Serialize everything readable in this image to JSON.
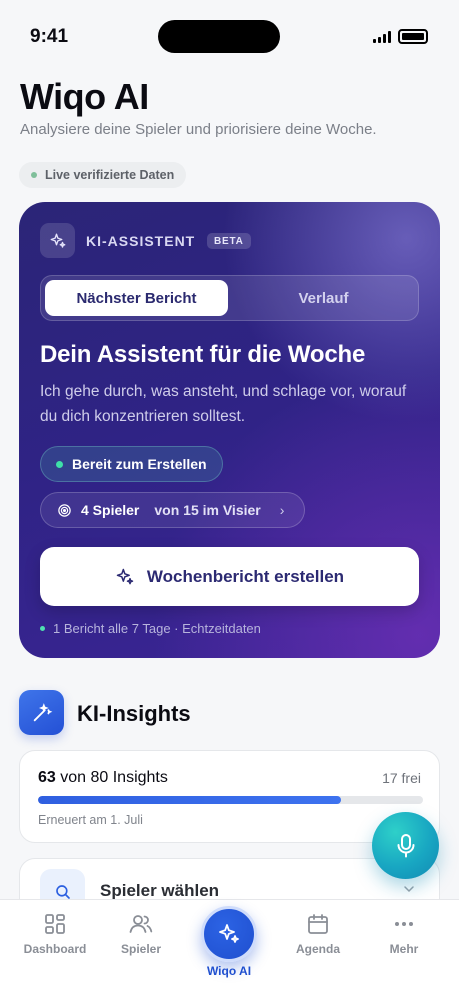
{
  "status_bar": {
    "time": "9:41"
  },
  "header": {
    "title": "Wiqo AI",
    "subtitle": "Analysiere deine Spieler und priorisiere deine Woche.",
    "live_badge": "Live verifizierte Daten"
  },
  "assistant": {
    "label": "KI-ASSISTENT",
    "badge": "BETA",
    "tabs": [
      {
        "label": "Nächster Bericht",
        "active": true
      },
      {
        "label": "Verlauf",
        "active": false
      }
    ],
    "heading": "Dein Assistent für die Woche",
    "description": "Ich gehe durch, was ansteht, und schlage vor, worauf du dich konzentrieren solltest.",
    "status": "Bereit zum Erstellen",
    "focus": {
      "count_label": "4 Spieler",
      "rest_label": "von 15 im Visier"
    },
    "button_label": "Wochenbericht erstellen",
    "footer": "1 Bericht alle 7 Tage · Echtzeitdaten"
  },
  "insights": {
    "title": "KI-Insights",
    "used": "63",
    "used_suffix": "von 80 Insights",
    "free": "17 frei",
    "progress": 0.7875,
    "renewed": "Erneuert am 1. Juli"
  },
  "select_player": {
    "label": "Spieler wählen"
  },
  "tab_bar": {
    "items": [
      {
        "label": "Dashboard",
        "icon": "grid-icon"
      },
      {
        "label": "Spieler",
        "icon": "users-icon"
      },
      {
        "label": "Wiqo AI",
        "icon": "sparkles-icon",
        "active": true
      },
      {
        "label": "Agenda",
        "icon": "calendar-icon"
      },
      {
        "label": "Mehr",
        "icon": "more-icon"
      }
    ]
  },
  "colors": {
    "accent": "#1f4fcf",
    "card_purple": "#2f2385",
    "teal": "#18a6c2",
    "ready_green": "#3ee0a8"
  }
}
